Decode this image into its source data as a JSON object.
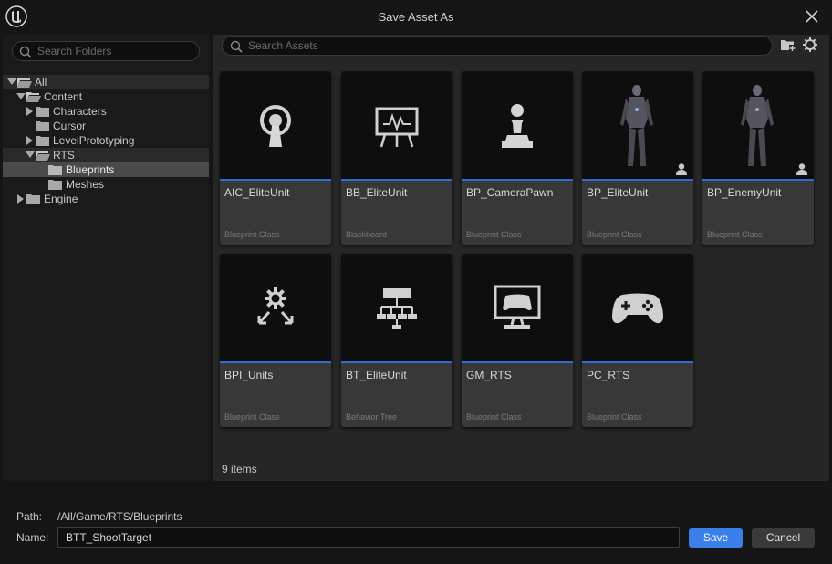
{
  "window": {
    "title": "Save Asset As",
    "logo_icon": "unreal-engine-logo-icon",
    "close_icon": "close-icon"
  },
  "folders": {
    "search_placeholder": "Search Folders",
    "tree": [
      {
        "label": "All",
        "state": "expanded"
      },
      {
        "label": "Content",
        "state": "expanded"
      },
      {
        "label": "Characters",
        "state": "collapsed"
      },
      {
        "label": "Cursor",
        "state": "leaf"
      },
      {
        "label": "LevelPrototyping",
        "state": "collapsed"
      },
      {
        "label": "RTS",
        "state": "expanded"
      },
      {
        "label": "Blueprints",
        "state": "leaf",
        "selected": true
      },
      {
        "label": "Meshes",
        "state": "leaf"
      },
      {
        "label": "Engine",
        "state": "collapsed"
      }
    ]
  },
  "assets": {
    "search_placeholder": "Search Assets",
    "items": [
      {
        "name": "AIC_EliteUnit",
        "type": "Blueprint Class",
        "icon": "ai-controller-icon"
      },
      {
        "name": "BB_EliteUnit",
        "type": "Blackboard",
        "icon": "blackboard-icon"
      },
      {
        "name": "BP_CameraPawn",
        "type": "Blueprint Class",
        "icon": "pawn-icon"
      },
      {
        "name": "BP_EliteUnit",
        "type": "Blueprint Class",
        "icon": "character-thumbnail"
      },
      {
        "name": "BP_EnemyUnit",
        "type": "Blueprint Class",
        "icon": "character-thumbnail"
      },
      {
        "name": "BPI_Units",
        "type": "Blueprint Class",
        "icon": "blueprint-interface-icon"
      },
      {
        "name": "BT_EliteUnit",
        "type": "Behavior Tree",
        "icon": "behavior-tree-icon"
      },
      {
        "name": "GM_RTS",
        "type": "Blueprint Class",
        "icon": "game-mode-icon"
      },
      {
        "name": "PC_RTS",
        "type": "Blueprint Class",
        "icon": "gamepad-icon"
      }
    ],
    "count_label": "9 items"
  },
  "footer": {
    "path_label": "Path:",
    "path_value": "/All/Game/RTS/Blueprints",
    "name_label": "Name:",
    "name_value": "BTT_ShootTarget",
    "save_label": "Save",
    "cancel_label": "Cancel"
  },
  "colors": {
    "accent": "#3b80ea",
    "tile_underline": "#2f6bd6",
    "background": "#151515"
  }
}
